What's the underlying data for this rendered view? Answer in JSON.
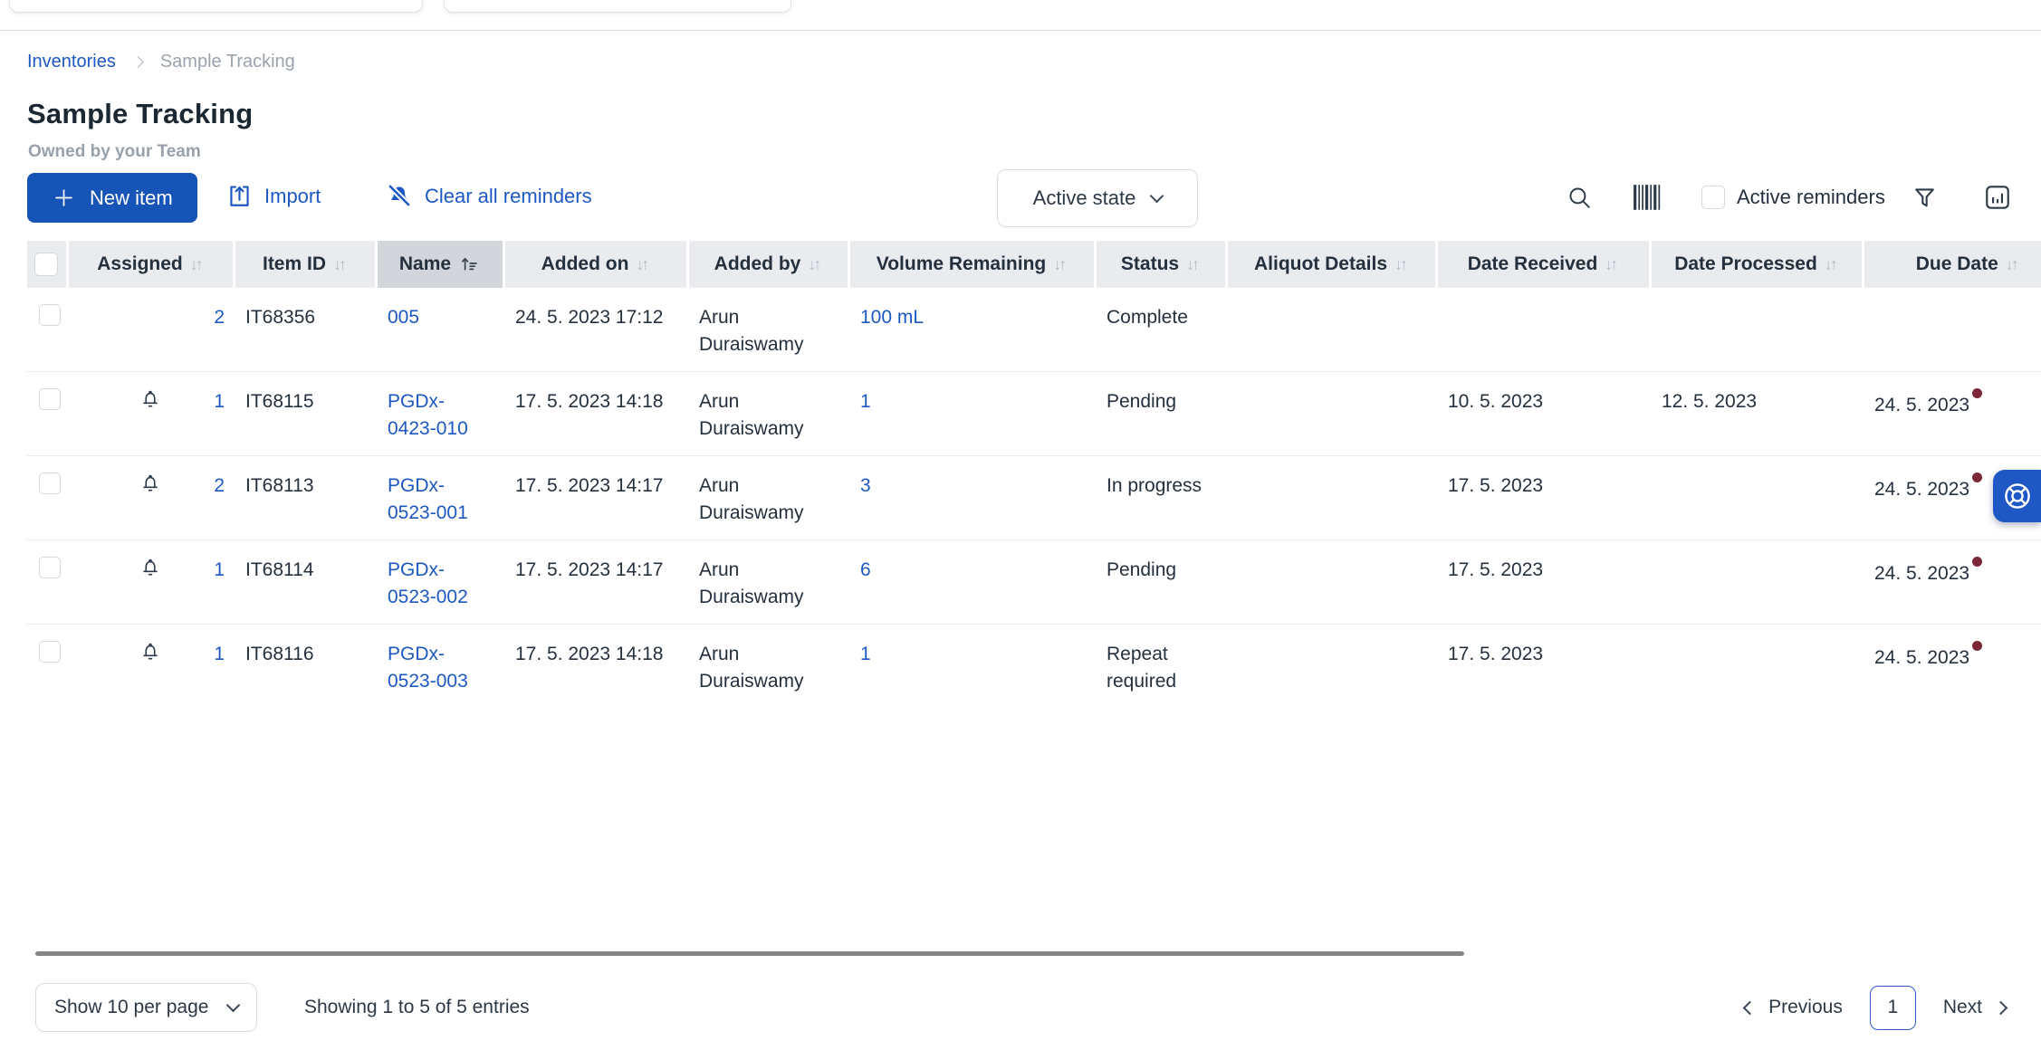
{
  "breadcrumb": {
    "parent": "Inventories",
    "current": "Sample Tracking"
  },
  "header": {
    "title": "Sample Tracking",
    "subtitle": "Owned by your Team"
  },
  "toolbar": {
    "new_item_label": "New item",
    "import_label": "Import",
    "clear_reminders_label": "Clear all reminders",
    "state_filter_value": "Active state",
    "active_reminders_label": "Active reminders",
    "active_reminders_checked": false
  },
  "icons": {
    "sort_inactive": "↓↑"
  },
  "colors": {
    "accent": "#1754b8",
    "link": "#1d58c2",
    "alert_dot": "#7c2838",
    "header_bg": "#e9ebee",
    "sorted_header_bg": "#d2d6db"
  },
  "table": {
    "columns": [
      {
        "id": "checkbox",
        "label": "",
        "sortable": false,
        "sorted": null
      },
      {
        "id": "assigned",
        "label": "Assigned",
        "sortable": true,
        "sorted": null
      },
      {
        "id": "item_id",
        "label": "Item ID",
        "sortable": true,
        "sorted": null
      },
      {
        "id": "name",
        "label": "Name",
        "sortable": true,
        "sorted": "asc"
      },
      {
        "id": "added_on",
        "label": "Added on",
        "sortable": true,
        "sorted": null
      },
      {
        "id": "added_by",
        "label": "Added by",
        "sortable": true,
        "sorted": null
      },
      {
        "id": "volume_remaining",
        "label": "Volume Remaining",
        "sortable": true,
        "sorted": null
      },
      {
        "id": "status",
        "label": "Status",
        "sortable": true,
        "sorted": null
      },
      {
        "id": "aliquot_details",
        "label": "Aliquot Details",
        "sortable": true,
        "sorted": null
      },
      {
        "id": "date_received",
        "label": "Date Received",
        "sortable": true,
        "sorted": null
      },
      {
        "id": "date_processed",
        "label": "Date Processed",
        "sortable": true,
        "sorted": null
      },
      {
        "id": "due_date",
        "label": "Due Date",
        "sortable": true,
        "sorted": null
      }
    ],
    "rows": [
      {
        "reminder": false,
        "assigned": "2",
        "item_id": "IT68356",
        "name": "005",
        "added_on": "24. 5. 2023 17:12",
        "added_by": "Arun Duraiswamy",
        "volume_remaining": "100 mL",
        "status": "Complete",
        "aliquot_details": "",
        "date_received": "",
        "date_processed": "",
        "due_date": "",
        "due_alert": false
      },
      {
        "reminder": true,
        "assigned": "1",
        "item_id": "IT68115",
        "name": "PGDx-0423-010",
        "added_on": "17. 5. 2023 14:18",
        "added_by": "Arun Duraiswamy",
        "volume_remaining": "1",
        "status": "Pending",
        "aliquot_details": "",
        "date_received": "10. 5. 2023",
        "date_processed": "12. 5. 2023",
        "due_date": "24. 5. 2023",
        "due_alert": true
      },
      {
        "reminder": true,
        "assigned": "2",
        "item_id": "IT68113",
        "name": "PGDx-0523-001",
        "added_on": "17. 5. 2023 14:17",
        "added_by": "Arun Duraiswamy",
        "volume_remaining": "3",
        "status": "In progress",
        "aliquot_details": "",
        "date_received": "17. 5. 2023",
        "date_processed": "",
        "due_date": "24. 5. 2023",
        "due_alert": true
      },
      {
        "reminder": true,
        "assigned": "1",
        "item_id": "IT68114",
        "name": "PGDx-0523-002",
        "added_on": "17. 5. 2023 14:17",
        "added_by": "Arun Duraiswamy",
        "volume_remaining": "6",
        "status": "Pending",
        "aliquot_details": "",
        "date_received": "17. 5. 2023",
        "date_processed": "",
        "due_date": "24. 5. 2023",
        "due_alert": true
      },
      {
        "reminder": true,
        "assigned": "1",
        "item_id": "IT68116",
        "name": "PGDx-0523-003",
        "added_on": "17. 5. 2023 14:18",
        "added_by": "Arun Duraiswamy",
        "volume_remaining": "1",
        "status": "Repeat required",
        "aliquot_details": "",
        "date_received": "17. 5. 2023",
        "date_processed": "",
        "due_date": "24. 5. 2023",
        "due_alert": true
      }
    ]
  },
  "pagination": {
    "page_size_value": "Show 10 per page",
    "summary": "Showing 1 to 5 of 5 entries",
    "previous_label": "Previous",
    "current_page": "1",
    "next_label": "Next"
  }
}
